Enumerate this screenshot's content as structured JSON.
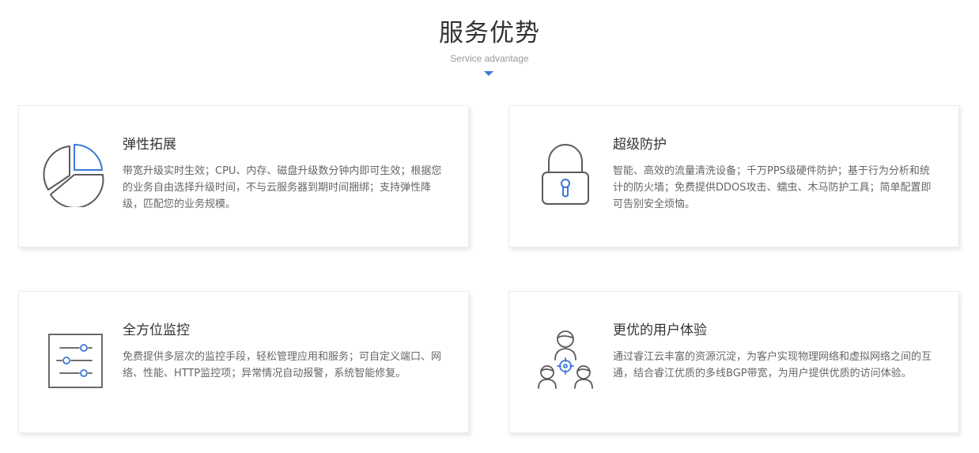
{
  "header": {
    "title": "服务优势",
    "subtitle": "Service advantage"
  },
  "colors": {
    "accent": "#3a78d8",
    "icon_stroke": "#5a5a5a",
    "title_text": "#333333",
    "desc_text": "#666666"
  },
  "cards": [
    {
      "icon": "pie-chart-icon",
      "title": "弹性拓展",
      "desc": "带宽升级实时生效；CPU、内存、磁盘升级数分钟内即可生效；根据您的业务自由选择升级时间，不与云服务器到期时间捆绑；支持弹性降级，匹配您的业务规模。"
    },
    {
      "icon": "padlock-icon",
      "title": "超级防护",
      "desc": "智能、高效的流量清洗设备；千万PPS级硬件防护；基于行为分析和统计的防火墙；免费提供DDOS攻击、蠕虫、木马防护工具；简单配置即可告别安全烦恼。"
    },
    {
      "icon": "monitor-sliders-icon",
      "title": "全方位监控",
      "desc": "免费提供多层次的监控手段，轻松管理应用和服务；可自定义端口、网络、性能、HTTP监控项；异常情况自动报警，系统智能修复。"
    },
    {
      "icon": "users-target-icon",
      "title": "更优的用户体验",
      "desc": "通过睿江云丰富的资源沉淀，为客户实现物理网络和虚拟网络之间的互通，结合睿江优质的多线BGP带宽，为用户提供优质的访问体验。"
    }
  ]
}
